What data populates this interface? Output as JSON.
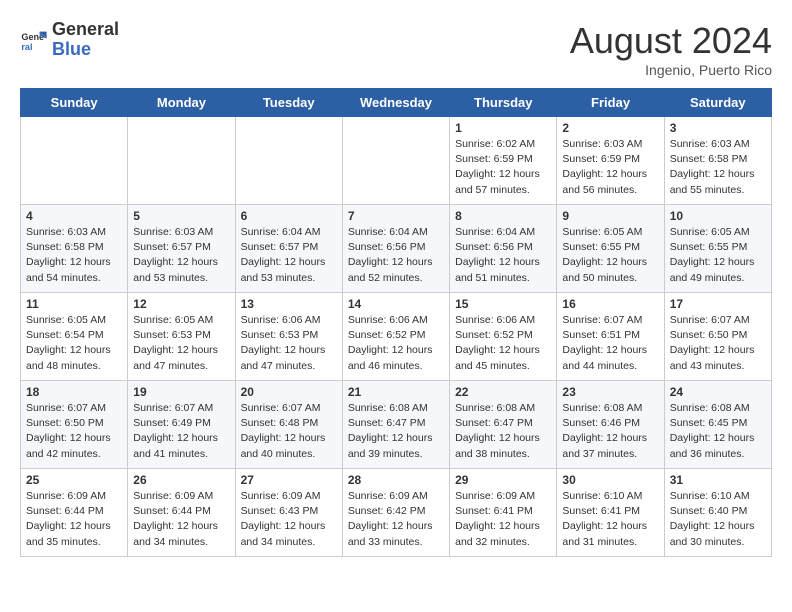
{
  "header": {
    "logo_general": "General",
    "logo_blue": "Blue",
    "month_title": "August 2024",
    "location": "Ingenio, Puerto Rico"
  },
  "days_of_week": [
    "Sunday",
    "Monday",
    "Tuesday",
    "Wednesday",
    "Thursday",
    "Friday",
    "Saturday"
  ],
  "weeks": [
    [
      {
        "day": "",
        "info": ""
      },
      {
        "day": "",
        "info": ""
      },
      {
        "day": "",
        "info": ""
      },
      {
        "day": "",
        "info": ""
      },
      {
        "day": "1",
        "info": "Sunrise: 6:02 AM\nSunset: 6:59 PM\nDaylight: 12 hours\nand 57 minutes."
      },
      {
        "day": "2",
        "info": "Sunrise: 6:03 AM\nSunset: 6:59 PM\nDaylight: 12 hours\nand 56 minutes."
      },
      {
        "day": "3",
        "info": "Sunrise: 6:03 AM\nSunset: 6:58 PM\nDaylight: 12 hours\nand 55 minutes."
      }
    ],
    [
      {
        "day": "4",
        "info": "Sunrise: 6:03 AM\nSunset: 6:58 PM\nDaylight: 12 hours\nand 54 minutes."
      },
      {
        "day": "5",
        "info": "Sunrise: 6:03 AM\nSunset: 6:57 PM\nDaylight: 12 hours\nand 53 minutes."
      },
      {
        "day": "6",
        "info": "Sunrise: 6:04 AM\nSunset: 6:57 PM\nDaylight: 12 hours\nand 53 minutes."
      },
      {
        "day": "7",
        "info": "Sunrise: 6:04 AM\nSunset: 6:56 PM\nDaylight: 12 hours\nand 52 minutes."
      },
      {
        "day": "8",
        "info": "Sunrise: 6:04 AM\nSunset: 6:56 PM\nDaylight: 12 hours\nand 51 minutes."
      },
      {
        "day": "9",
        "info": "Sunrise: 6:05 AM\nSunset: 6:55 PM\nDaylight: 12 hours\nand 50 minutes."
      },
      {
        "day": "10",
        "info": "Sunrise: 6:05 AM\nSunset: 6:55 PM\nDaylight: 12 hours\nand 49 minutes."
      }
    ],
    [
      {
        "day": "11",
        "info": "Sunrise: 6:05 AM\nSunset: 6:54 PM\nDaylight: 12 hours\nand 48 minutes."
      },
      {
        "day": "12",
        "info": "Sunrise: 6:05 AM\nSunset: 6:53 PM\nDaylight: 12 hours\nand 47 minutes."
      },
      {
        "day": "13",
        "info": "Sunrise: 6:06 AM\nSunset: 6:53 PM\nDaylight: 12 hours\nand 47 minutes."
      },
      {
        "day": "14",
        "info": "Sunrise: 6:06 AM\nSunset: 6:52 PM\nDaylight: 12 hours\nand 46 minutes."
      },
      {
        "day": "15",
        "info": "Sunrise: 6:06 AM\nSunset: 6:52 PM\nDaylight: 12 hours\nand 45 minutes."
      },
      {
        "day": "16",
        "info": "Sunrise: 6:07 AM\nSunset: 6:51 PM\nDaylight: 12 hours\nand 44 minutes."
      },
      {
        "day": "17",
        "info": "Sunrise: 6:07 AM\nSunset: 6:50 PM\nDaylight: 12 hours\nand 43 minutes."
      }
    ],
    [
      {
        "day": "18",
        "info": "Sunrise: 6:07 AM\nSunset: 6:50 PM\nDaylight: 12 hours\nand 42 minutes."
      },
      {
        "day": "19",
        "info": "Sunrise: 6:07 AM\nSunset: 6:49 PM\nDaylight: 12 hours\nand 41 minutes."
      },
      {
        "day": "20",
        "info": "Sunrise: 6:07 AM\nSunset: 6:48 PM\nDaylight: 12 hours\nand 40 minutes."
      },
      {
        "day": "21",
        "info": "Sunrise: 6:08 AM\nSunset: 6:47 PM\nDaylight: 12 hours\nand 39 minutes."
      },
      {
        "day": "22",
        "info": "Sunrise: 6:08 AM\nSunset: 6:47 PM\nDaylight: 12 hours\nand 38 minutes."
      },
      {
        "day": "23",
        "info": "Sunrise: 6:08 AM\nSunset: 6:46 PM\nDaylight: 12 hours\nand 37 minutes."
      },
      {
        "day": "24",
        "info": "Sunrise: 6:08 AM\nSunset: 6:45 PM\nDaylight: 12 hours\nand 36 minutes."
      }
    ],
    [
      {
        "day": "25",
        "info": "Sunrise: 6:09 AM\nSunset: 6:44 PM\nDaylight: 12 hours\nand 35 minutes."
      },
      {
        "day": "26",
        "info": "Sunrise: 6:09 AM\nSunset: 6:44 PM\nDaylight: 12 hours\nand 34 minutes."
      },
      {
        "day": "27",
        "info": "Sunrise: 6:09 AM\nSunset: 6:43 PM\nDaylight: 12 hours\nand 34 minutes."
      },
      {
        "day": "28",
        "info": "Sunrise: 6:09 AM\nSunset: 6:42 PM\nDaylight: 12 hours\nand 33 minutes."
      },
      {
        "day": "29",
        "info": "Sunrise: 6:09 AM\nSunset: 6:41 PM\nDaylight: 12 hours\nand 32 minutes."
      },
      {
        "day": "30",
        "info": "Sunrise: 6:10 AM\nSunset: 6:41 PM\nDaylight: 12 hours\nand 31 minutes."
      },
      {
        "day": "31",
        "info": "Sunrise: 6:10 AM\nSunset: 6:40 PM\nDaylight: 12 hours\nand 30 minutes."
      }
    ]
  ]
}
